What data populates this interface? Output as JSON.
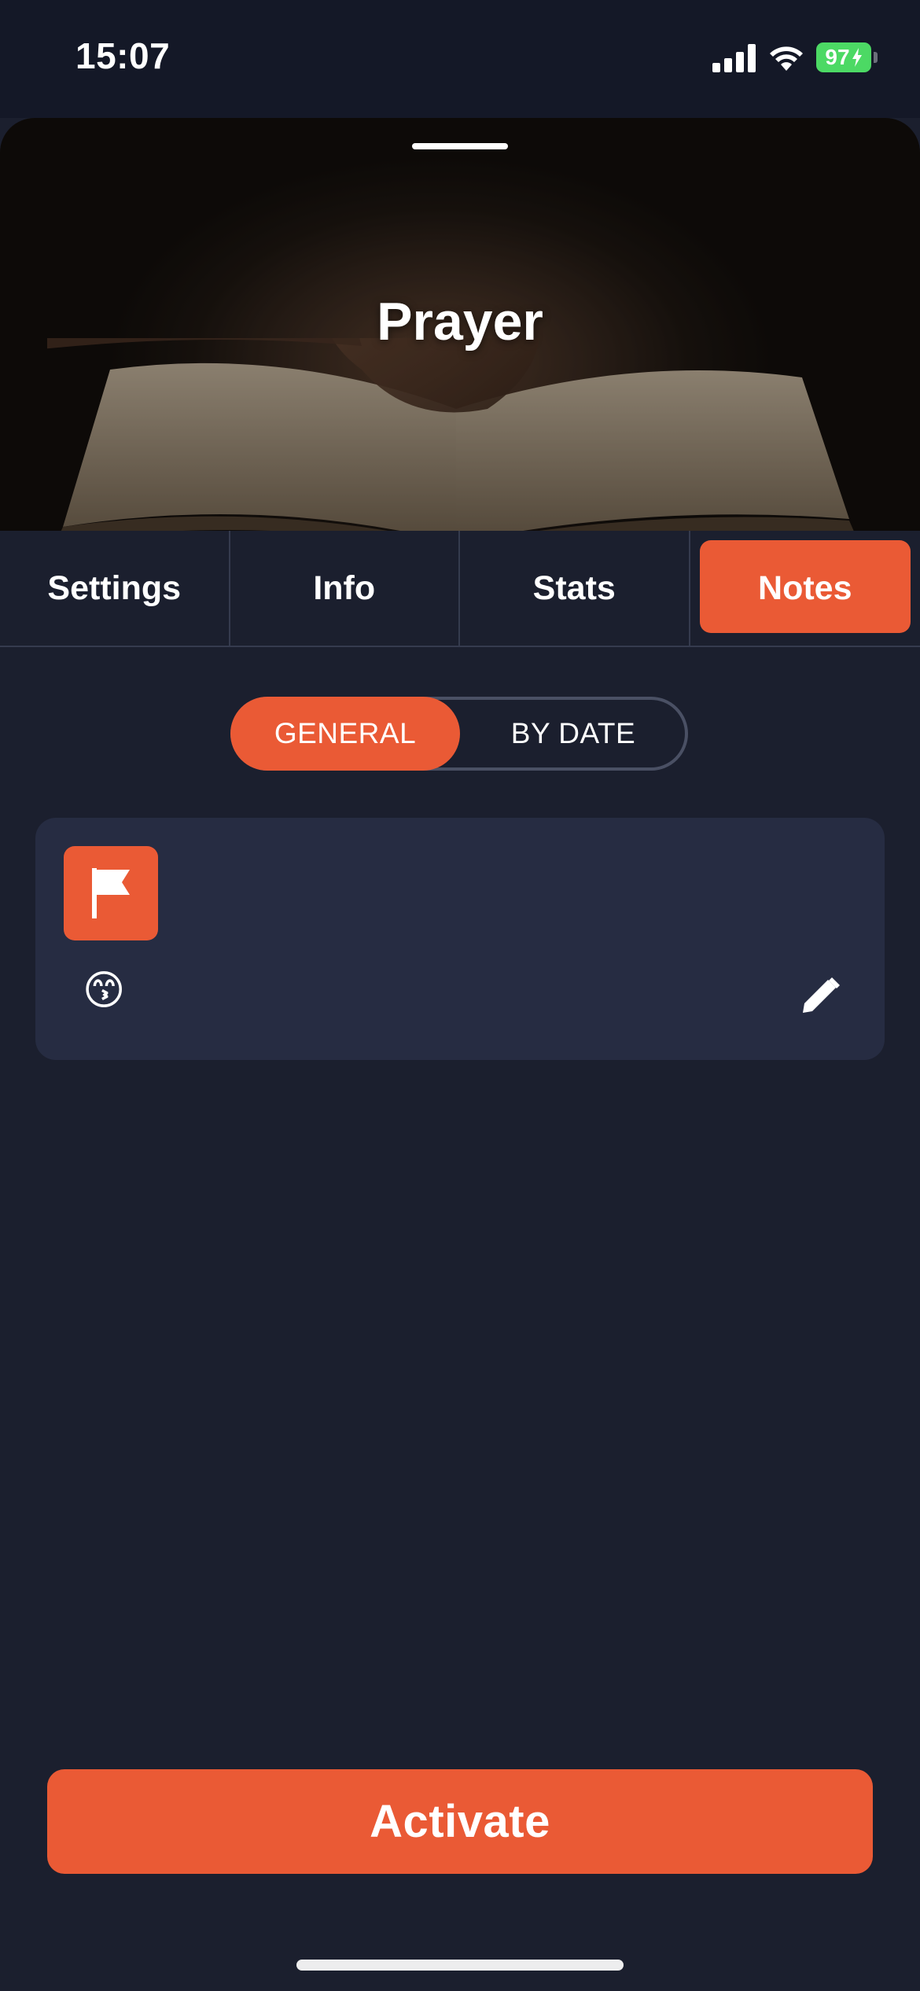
{
  "status_bar": {
    "time": "15:07",
    "battery": "97"
  },
  "header": {
    "title": "Prayer"
  },
  "tabs": [
    {
      "label": "Settings",
      "active": false
    },
    {
      "label": "Info",
      "active": false
    },
    {
      "label": "Stats",
      "active": false
    },
    {
      "label": "Notes",
      "active": true
    }
  ],
  "segment": {
    "general": "GENERAL",
    "by_date": "BY DATE",
    "selected": "GENERAL"
  },
  "note": {
    "emoji": "😙",
    "badge_icon": "flag-icon",
    "action_icon": "pencil-icon"
  },
  "primary_action": {
    "label": "Activate"
  },
  "colors": {
    "accent": "#ea5a35",
    "background": "#1b1f2e",
    "card": "#262c42"
  }
}
